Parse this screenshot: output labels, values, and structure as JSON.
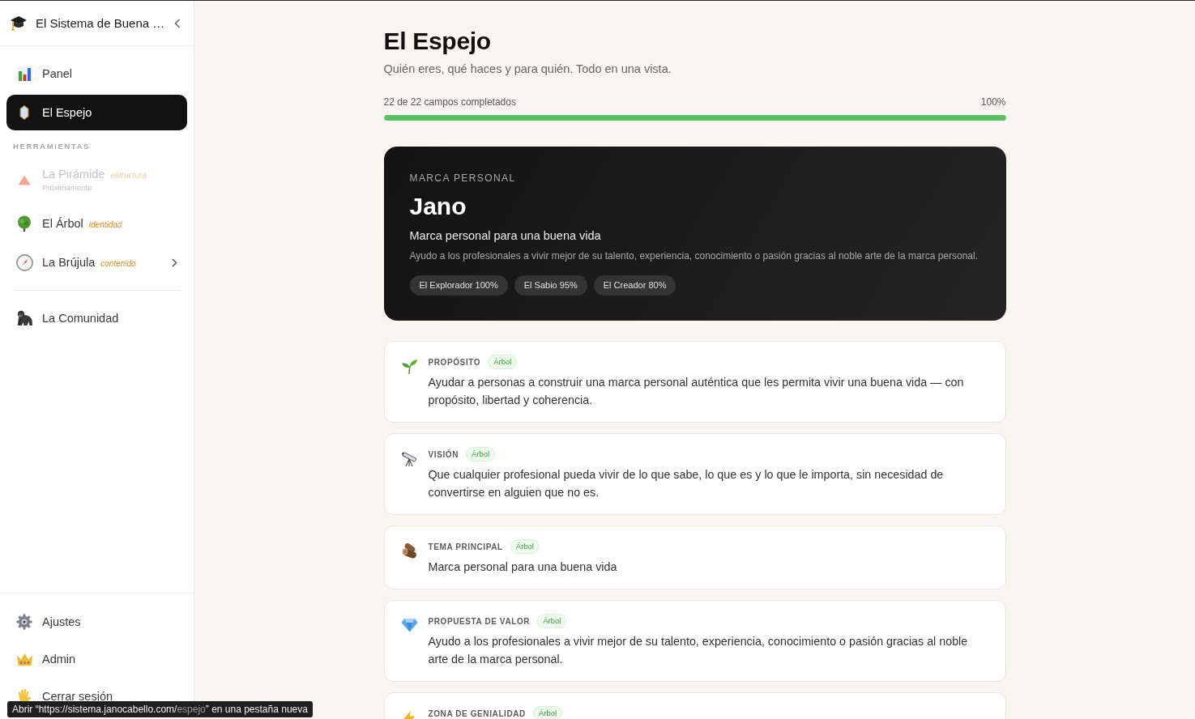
{
  "sidebar": {
    "title": "El Sistema de Buena …",
    "nav": [
      {
        "label": "Panel",
        "selected": false
      },
      {
        "label": "El Espejo",
        "selected": true
      }
    ],
    "section_label": "HERRAMIENTAS",
    "tools": [
      {
        "label": "La Pirámide",
        "tag": "estructura",
        "note": "Próximamente",
        "disabled": true,
        "has_submenu": false
      },
      {
        "label": "El Árbol",
        "tag": "identidad",
        "disabled": false,
        "has_submenu": false
      },
      {
        "label": "La Brújula",
        "tag": "contenido",
        "disabled": false,
        "has_submenu": true
      }
    ],
    "community": [
      {
        "label": "La Comunidad",
        "selected": false
      }
    ],
    "footer": [
      {
        "label": "Ajustes",
        "selected": false
      },
      {
        "label": "Admin",
        "selected": false
      },
      {
        "label": "Cerrar sesión",
        "selected": false
      }
    ]
  },
  "page": {
    "title": "El Espejo",
    "subtitle": "Quién eres, qué haces y para quién. Todo en una vista."
  },
  "progress": {
    "label": "22 de 22 campos completados",
    "percent": "100%",
    "level": 1
  },
  "hero": {
    "eyebrow": "MARCA PERSONAL",
    "name": "Jano",
    "tagline": "Marca personal para una buena vida",
    "description": "Ayudo a los profesionales a vivir mejor de su talento, experiencia, conocimiento o pasión gracias al noble arte de la marca personal.",
    "archetypes": [
      "El Explorador 100%",
      "El Sabio 95%",
      "El Creador 80%"
    ]
  },
  "fields": [
    {
      "label": "PROPÓSITO",
      "tag": "Árbol",
      "text": "Ayudar a personas a construir una marca personal auténtica que les permita vivir una buena vida — con propósito, libertad y coherencia."
    },
    {
      "label": "VISIÓN",
      "tag": "Árbol",
      "text": "Que cualquier profesional pueda vivir de lo que sabe, lo que es y lo que le importa, sin necesidad de convertirse en alguien que no es."
    },
    {
      "label": "TEMA PRINCIPAL",
      "tag": "Árbol",
      "text": "Marca personal para una buena vida"
    },
    {
      "label": "PROPUESTA DE VALOR",
      "tag": "Árbol",
      "text": "Ayudo a los profesionales a vivir mejor de su talento, experiencia, conocimiento o pasión gracias al noble arte de la marca personal."
    },
    {
      "label": "ZONA DE GENIALIDAD",
      "tag": "Árbol"
    }
  ],
  "link_status": {
    "prefix": "Abrir “https://sistema.janocabello.com/",
    "path": "espejo",
    "suffix": "” en una pestaña nueva"
  }
}
